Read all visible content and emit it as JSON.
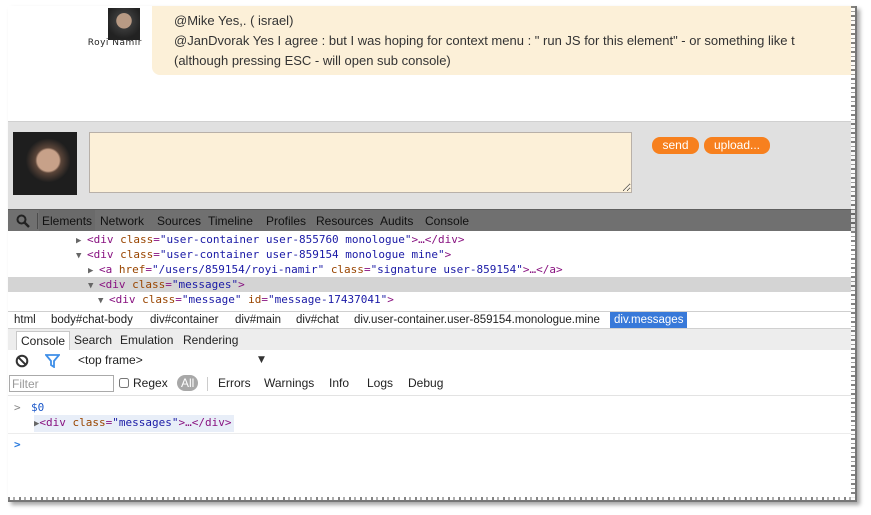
{
  "chat": {
    "user_name": "Royi Namir",
    "messages": [
      "@Mike Yes,. ( israel)",
      "@JanDvorak Yes I agree : but I was hoping for context menu : \" run JS for this element\" - or something like t",
      "(although pressing ESC - will open sub console)"
    ],
    "input_value": "",
    "send_label": "send",
    "upload_label": "upload..."
  },
  "colors": {
    "bubble_bg": "#fcf0d8",
    "button_orange": "#f7801e",
    "breadcrumb_active": "#3879d9",
    "tag_color": "#881280",
    "attr_color": "#994500",
    "value_color": "#1a1aa6"
  },
  "devtools": {
    "search_icon": "magnifier-icon",
    "tabs": [
      "Elements",
      "Network",
      "Sources",
      "Timeline",
      "Profiles",
      "Resources",
      "Audits",
      "Console"
    ],
    "active_tab": "Elements",
    "dom_tree": [
      {
        "indent": 1,
        "arrow": "▶",
        "open_tag": "<div",
        "attr": "class",
        "value": "\"user-container user-855760 monologue\"",
        "close": ">…</div>"
      },
      {
        "indent": 1,
        "arrow": "▼",
        "open_tag": "<div",
        "attr": "class",
        "value": "\"user-container user-859154 monologue mine\"",
        "close": ">"
      },
      {
        "indent": 2,
        "arrow": "▶",
        "open_tag": "<a",
        "attr": "href",
        "value": "\"/users/859154/royi-namir\"",
        "attr2": "class",
        "value2": "\"signature user-859154\"",
        "close": ">…</a>"
      },
      {
        "indent": 2,
        "arrow": "▼",
        "open_tag": "<div",
        "attr": "class",
        "value": "\"messages\"",
        "close": ">",
        "selected": true
      },
      {
        "indent": 3,
        "arrow": "▼",
        "open_tag": "<div",
        "attr": "class",
        "value": "\"message\"",
        "attr2": "id",
        "value2": "\"message-17437041\"",
        "close": ">"
      }
    ],
    "breadcrumbs": [
      "html",
      "body#chat-body",
      "div#container",
      "div#main",
      "div#chat",
      "div.user-container.user-859154.monologue.mine",
      "div.messages"
    ],
    "active_breadcrumb": "div.messages",
    "drawer_tabs": [
      "Console",
      "Search",
      "Emulation",
      "Rendering"
    ],
    "active_drawer_tab": "Console",
    "console": {
      "clear_icon": "no-entry-icon",
      "filter_icon": "funnel-icon",
      "frame_selector": "<top frame>",
      "filter_placeholder": "Filter",
      "regex_label": "Regex",
      "regex_checked": false,
      "levels": [
        "All",
        "Errors",
        "Warnings",
        "Info",
        "Logs",
        "Debug"
      ],
      "active_level": "All",
      "entries": [
        {
          "prompt": ">",
          "input": "$0"
        },
        {
          "result_arrow": "▶",
          "open_tag": "<div",
          "attr": "class",
          "value": "\"messages\"",
          "close": ">…</div>"
        }
      ],
      "current_prompt": ">"
    }
  }
}
